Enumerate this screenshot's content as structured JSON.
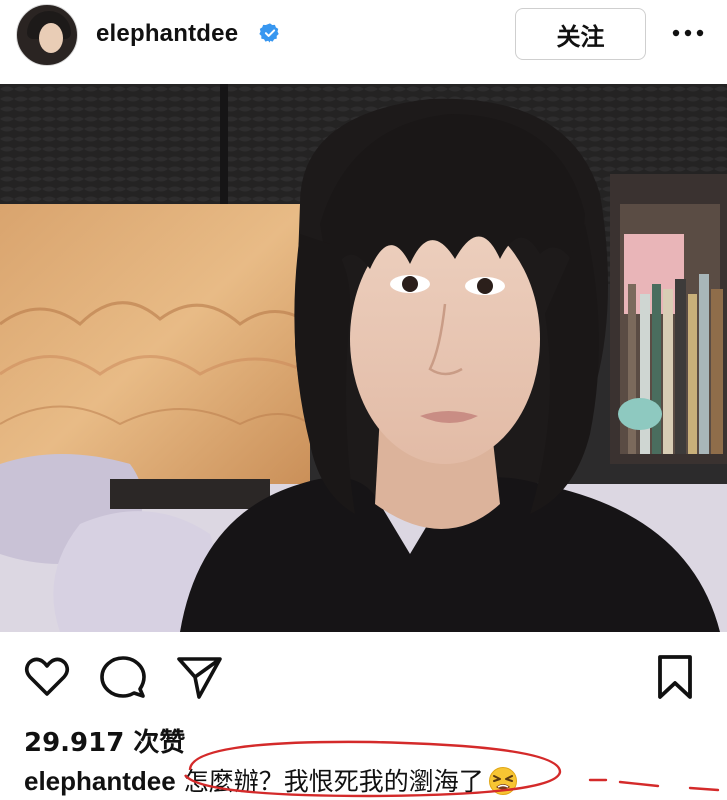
{
  "header": {
    "username": "elephantdee",
    "follow_label": "关注"
  },
  "icons": {
    "verified": "verified-badge-icon",
    "more": "more-options-icon",
    "like": "heart-icon",
    "comment": "comment-bubble-icon",
    "share": "paper-plane-icon",
    "save": "bookmark-icon",
    "emoji": "tired-face-emoji"
  },
  "colors": {
    "verified_blue": "#3897f0",
    "annotation_red": "#d42a2a"
  },
  "post": {
    "likes_text": "29.917 次赞",
    "caption_user": "elephantdee",
    "caption_text": "怎麼辦？我恨死我的瀏海了"
  }
}
